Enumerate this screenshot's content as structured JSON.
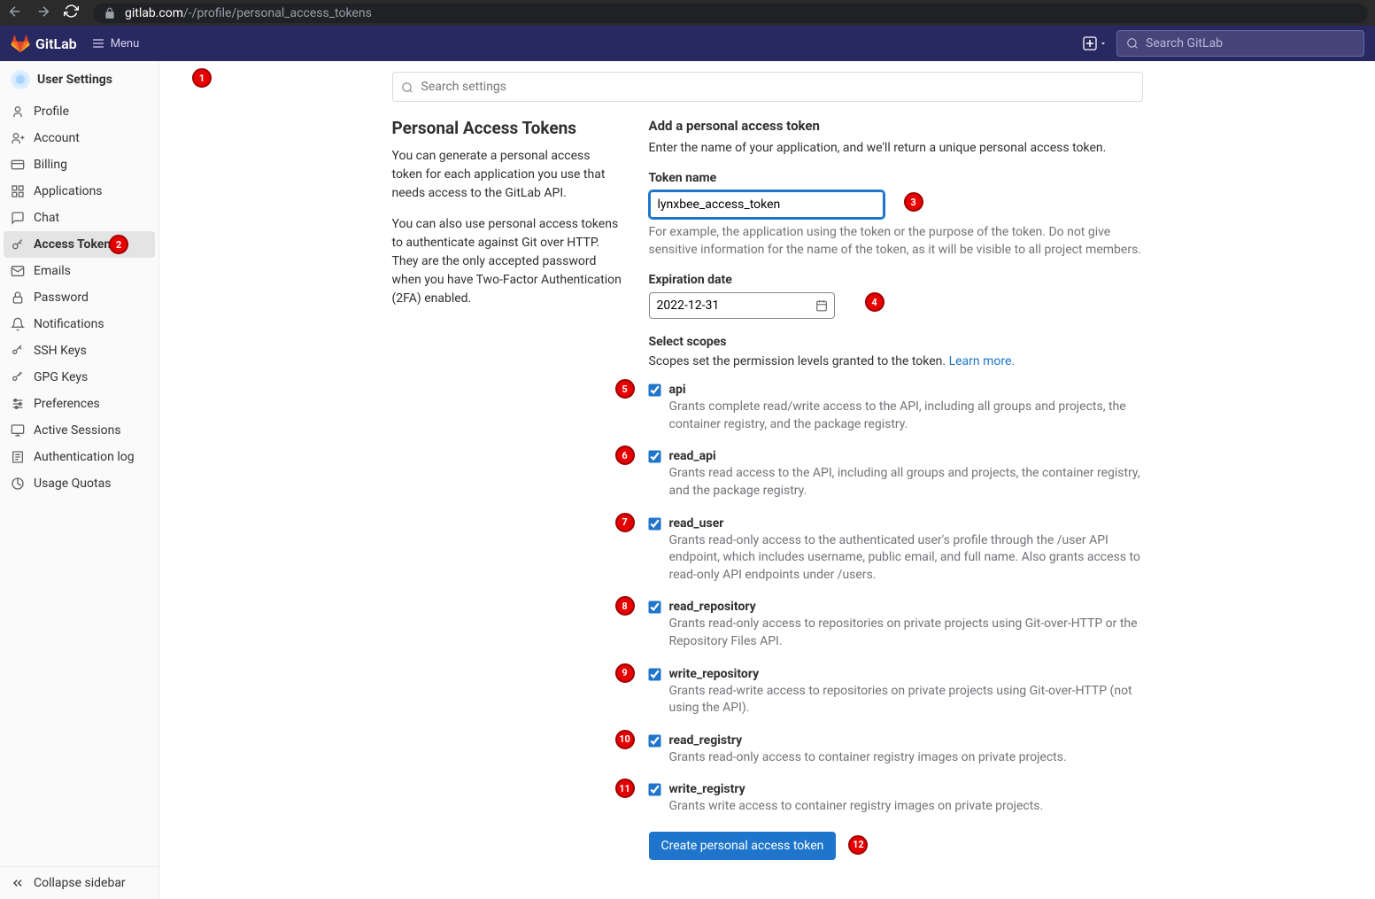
{
  "browser": {
    "url_domain": "gitlab.com",
    "url_path": "/-/profile/personal_access_tokens"
  },
  "header": {
    "brand": "GitLab",
    "menu_label": "Menu",
    "search_placeholder": "Search GitLab"
  },
  "sidebar": {
    "title": "User Settings",
    "items": [
      {
        "label": "Profile",
        "icon": "user"
      },
      {
        "label": "Account",
        "icon": "account"
      },
      {
        "label": "Billing",
        "icon": "card"
      },
      {
        "label": "Applications",
        "icon": "apps"
      },
      {
        "label": "Chat",
        "icon": "chat"
      },
      {
        "label": "Access Tokens",
        "icon": "key",
        "active": true
      },
      {
        "label": "Emails",
        "icon": "mail"
      },
      {
        "label": "Password",
        "icon": "lock"
      },
      {
        "label": "Notifications",
        "icon": "bell"
      },
      {
        "label": "SSH Keys",
        "icon": "ssh"
      },
      {
        "label": "GPG Keys",
        "icon": "gpg"
      },
      {
        "label": "Preferences",
        "icon": "prefs"
      },
      {
        "label": "Active Sessions",
        "icon": "sessions"
      },
      {
        "label": "Authentication log",
        "icon": "log"
      },
      {
        "label": "Usage Quotas",
        "icon": "quota"
      }
    ],
    "collapse_label": "Collapse sidebar"
  },
  "content": {
    "search_placeholder": "Search settings",
    "page_title": "Personal Access Tokens",
    "desc1": "You can generate a personal access token for each application you use that needs access to the GitLab API.",
    "desc2": "You can also use personal access tokens to authenticate against Git over HTTP. They are the only accepted password when you have Two-Factor Authentication (2FA) enabled.",
    "add_title": "Add a personal access token",
    "add_sub": "Enter the name of your application, and we'll return a unique personal access token.",
    "token_name_label": "Token name",
    "token_name_value": "lynxbee_access_token",
    "token_name_help": "For example, the application using the token or the purpose of the token. Do not give sensitive information for the name of the token, as it will be visible to all project members.",
    "expiration_label": "Expiration date",
    "expiration_value": "2022-12-31",
    "scopes_label": "Select scopes",
    "scopes_desc": "Scopes set the permission levels granted to the token. ",
    "scopes_learn_more": "Learn more.",
    "scopes": [
      {
        "name": "api",
        "desc": "Grants complete read/write access to the API, including all groups and projects, the container registry, and the package registry.",
        "checked": true
      },
      {
        "name": "read_api",
        "desc": "Grants read access to the API, including all groups and projects, the container registry, and the package registry.",
        "checked": true
      },
      {
        "name": "read_user",
        "desc": "Grants read-only access to the authenticated user's profile through the /user API endpoint, which includes username, public email, and full name. Also grants access to read-only API endpoints under /users.",
        "checked": true
      },
      {
        "name": "read_repository",
        "desc": "Grants read-only access to repositories on private projects using Git-over-HTTP or the Repository Files API.",
        "checked": true
      },
      {
        "name": "write_repository",
        "desc": "Grants read-write access to repositories on private projects using Git-over-HTTP (not using the API).",
        "checked": true
      },
      {
        "name": "read_registry",
        "desc": "Grants read-only access to container registry images on private projects.",
        "checked": true
      },
      {
        "name": "write_registry",
        "desc": "Grants write access to container registry images on private projects.",
        "checked": true
      }
    ],
    "create_btn": "Create personal access token"
  },
  "annotations": [
    "1",
    "2",
    "3",
    "4",
    "5",
    "6",
    "7",
    "8",
    "9",
    "10",
    "11",
    "12"
  ]
}
